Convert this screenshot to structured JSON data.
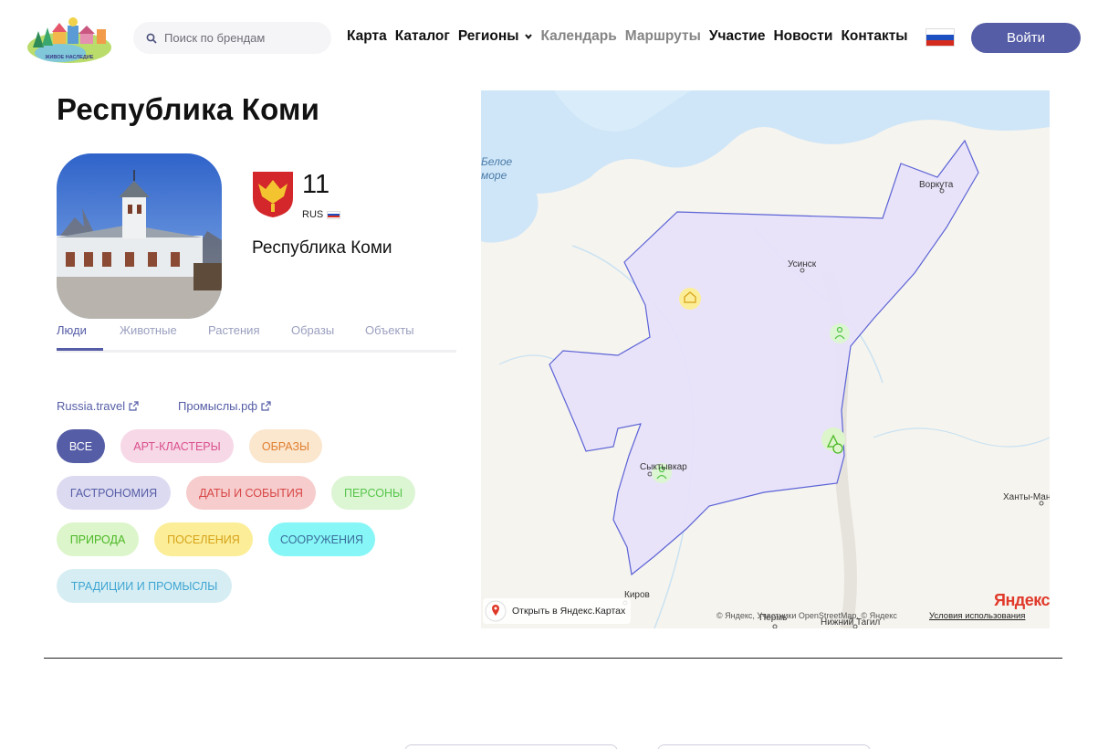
{
  "header": {
    "search_placeholder": "Поиск по брендам",
    "nav": [
      "Карта",
      "Каталог",
      "Регионы",
      "Календарь",
      "Маршруты",
      "Участие",
      "Новости",
      "Контакты"
    ],
    "login_label": "Войти",
    "logo_text": "ЖИВОЕ НАСЛЕДИЕ"
  },
  "region": {
    "title": "Республика Коми",
    "code": "11",
    "country": "RUS",
    "name": "Республика Коми"
  },
  "tabs": [
    "Люди",
    "Животные",
    "Растения",
    "Образы",
    "Объекты"
  ],
  "links": [
    "Russia.travel",
    "Промыслы.рф"
  ],
  "chips": [
    "Все",
    "Арт-кластеры",
    "Образы",
    "Гастрономия",
    "Даты и события",
    "Персоны",
    "Природа",
    "Поселения",
    "Сооружения",
    "Традиции и промыслы"
  ],
  "map": {
    "labels": {
      "sea": "Белое море",
      "vorkuta": "Воркута",
      "usinsk": "Усинск",
      "syktyvkar": "Сыктывкар",
      "kirov": "Киров",
      "perm": "Пермь",
      "nizhny_tagil": "Нижний Тагил",
      "khanty": "Ханты-Ман"
    },
    "open_label": "Открыть в Яндекс.Картах",
    "attribution": "© Яндекс, Участники OpenStreetMap, © Яндекс",
    "terms": "Условия использования",
    "logo": "Яндекс"
  },
  "colors": {
    "accent": "#555da6",
    "region_fill": "#e8e1fb",
    "region_border": "#5b63d6"
  }
}
